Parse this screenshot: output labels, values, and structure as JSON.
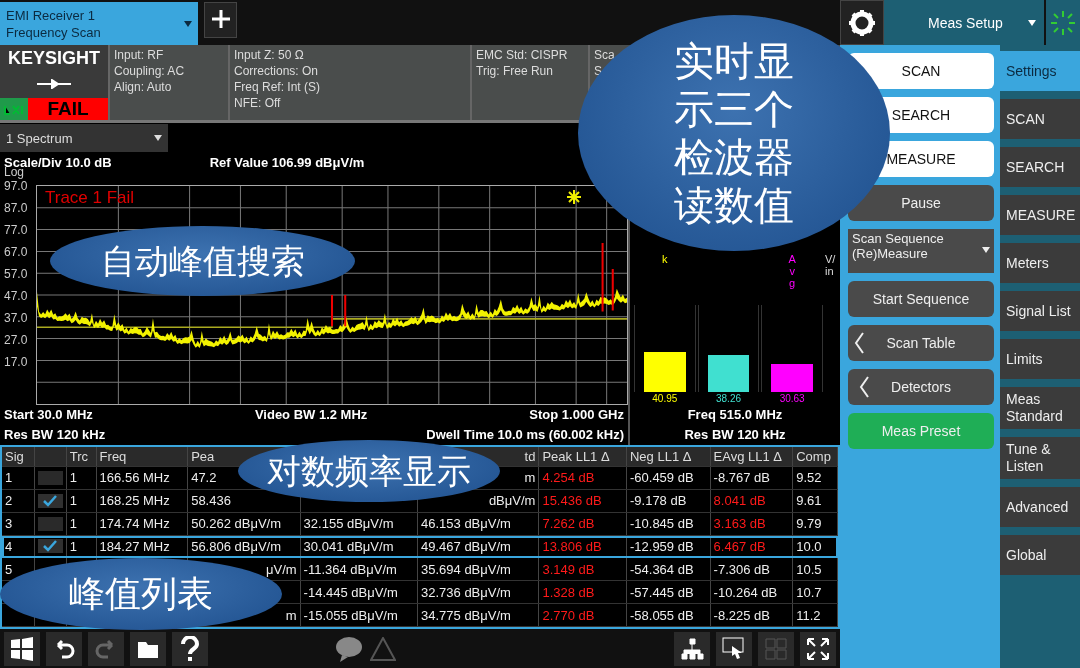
{
  "tab": {
    "line1": "EMI Receiver 1",
    "line2": "Frequency Scan"
  },
  "header": {
    "logo": "KEYSIGHT",
    "status": "FAIL",
    "info_columns": [
      [
        "Input: RF",
        "Coupling: AC",
        "Align: Auto"
      ],
      [
        "Input Z: 50 Ω",
        "Corrections: On",
        "Freq Ref: Int (S)",
        "NFE: Off"
      ],
      [
        "EMC Std: CISPR",
        "Trig: Free Run"
      ],
      [
        "Sca",
        "S"
      ]
    ]
  },
  "window_select": "1 Spectrum",
  "chart": {
    "scale": "Scale/Div 10.0 dB",
    "ref": "Ref Value 106.99 dBμV/m",
    "scale_type": "Log",
    "trace_status": "Trace 1 Fail",
    "y_labels": [
      "97.0",
      "87.0",
      "77.0",
      "67.0",
      "57.0",
      "47.0",
      "37.0",
      "27.0",
      "17.0"
    ],
    "footer": [
      [
        "Start 30.0 MHz",
        "Video BW 1.2 MHz",
        "Stop 1.000 GHz"
      ],
      [
        "Res BW 120 kHz",
        "Dwell Time 10.0 ms (60.002 kHz)"
      ]
    ]
  },
  "meter": {
    "bars": [
      {
        "label": "k",
        "value": "40.95",
        "level": 0.46,
        "color": "#ffff00"
      },
      {
        "value": "38.26",
        "level": 0.42,
        "color": "#40e0d0"
      },
      {
        "label": "Avg",
        "value": "30.63",
        "level": 0.32,
        "color": "#ff00ff"
      }
    ],
    "side_label": "V/in",
    "freq": "Freq 515.0 MHz",
    "rbw": "Res BW 120 kHz"
  },
  "table": {
    "columns": [
      "Sig",
      "",
      "Trc",
      "Freq",
      "Pea",
      "",
      {
        "text": "td",
        "kind": "tail"
      },
      "Peak LL1 Δ",
      "Neg LL1 Δ",
      "EAvg LL1 Δ",
      "Comp"
    ],
    "rows": [
      {
        "selected": false,
        "cells": [
          "1",
          {
            "kind": "checkbox",
            "checked": false
          },
          "1",
          "166.56 MHz",
          "47.2",
          null,
          {
            "text": "m",
            "kind": "tail"
          },
          {
            "text": "4.254 dB",
            "fail": true
          },
          "-60.459 dB",
          "-8.767 dB",
          "9.52"
        ]
      },
      {
        "selected": false,
        "cells": [
          "2",
          {
            "kind": "checkbox",
            "checked": true
          },
          "1",
          "168.25 MHz",
          "58.436",
          null,
          {
            "text": "dBμV/m",
            "kind": "tail"
          },
          {
            "text": "15.436 dB",
            "fail": true
          },
          "-9.178 dB",
          {
            "text": "8.041 dB",
            "fail": true
          },
          "9.61"
        ]
      },
      {
        "selected": false,
        "cells": [
          "3",
          {
            "kind": "checkbox",
            "checked": false
          },
          "1",
          "174.74 MHz",
          "50.262 dBμV/m",
          "32.155 dBμV/m",
          "46.153 dBμV/m",
          {
            "text": "7.262 dB",
            "fail": true
          },
          "-10.845 dB",
          {
            "text": "3.163 dB",
            "fail": true
          },
          "9.79"
        ]
      },
      {
        "selected": true,
        "cells": [
          "4",
          {
            "kind": "checkbox",
            "checked": true
          },
          "1",
          "184.27 MHz",
          "56.806 dBμV/m",
          "30.041 dBμV/m",
          "49.467 dBμV/m",
          {
            "text": "13.806 dB",
            "fail": true
          },
          "-12.959 dB",
          {
            "text": "6.467 dB",
            "fail": true
          },
          "10.0"
        ]
      },
      {
        "selected": false,
        "cells": [
          "5",
          null,
          null,
          null,
          {
            "text": "μV/m",
            "kind": "tail"
          },
          "-11.364 dBμV/m",
          "35.694 dBμV/m",
          {
            "text": "3.149 dB",
            "fail": true
          },
          "-54.364 dB",
          "-7.306 dB",
          "10.5"
        ]
      },
      {
        "selected": false,
        "cells": [
          null,
          null,
          null,
          null,
          null,
          "-14.445 dBμV/m",
          "32.736 dBμV/m",
          {
            "text": "1.328 dB",
            "fail": true
          },
          "-57.445 dB",
          "-10.264 dB",
          "10.7"
        ]
      },
      {
        "selected": false,
        "cells": [
          null,
          null,
          null,
          null,
          {
            "text": "m",
            "kind": "tail"
          },
          "-15.055 dBμV/m",
          "34.775 dBμV/m",
          {
            "text": "2.770 dB",
            "fail": true
          },
          "-58.055 dB",
          "-8.225 dB",
          "11.2"
        ]
      }
    ]
  },
  "meas_setup": {
    "title": "Meas Setup",
    "buttons": [
      {
        "kind": "white",
        "label": "SCAN"
      },
      {
        "kind": "white",
        "label": "SEARCH"
      },
      {
        "kind": "white",
        "label": "MEASURE"
      },
      {
        "kind": "dark",
        "label": "Pause"
      },
      {
        "kind": "dropdown",
        "label": "Scan Sequence",
        "value": "(Re)Measure"
      },
      {
        "kind": "dark",
        "label": "Start Sequence"
      },
      {
        "kind": "submenu",
        "label": "Scan Table"
      },
      {
        "kind": "submenu",
        "label": "Detectors"
      },
      {
        "kind": "preset",
        "label": "Meas Preset"
      }
    ]
  },
  "menu_tabs": [
    {
      "label": "Settings",
      "selected": true
    },
    {
      "label": "SCAN",
      "selected": false
    },
    {
      "label": "SEARCH",
      "selected": false
    },
    {
      "label": "MEASURE",
      "selected": false
    },
    {
      "label": "Meters",
      "selected": false
    },
    {
      "label": "Signal List",
      "selected": false
    },
    {
      "label": "Limits",
      "selected": false
    },
    {
      "label": "Meas Standard",
      "selected": false
    },
    {
      "label": "Tune & Listen",
      "selected": false
    },
    {
      "label": "Advanced",
      "selected": false
    },
    {
      "label": "Global",
      "selected": false
    }
  ],
  "callouts": [
    "实时显示三个检波器读数值",
    "自动峰值搜索",
    "对数频率显示",
    "峰值列表"
  ]
}
